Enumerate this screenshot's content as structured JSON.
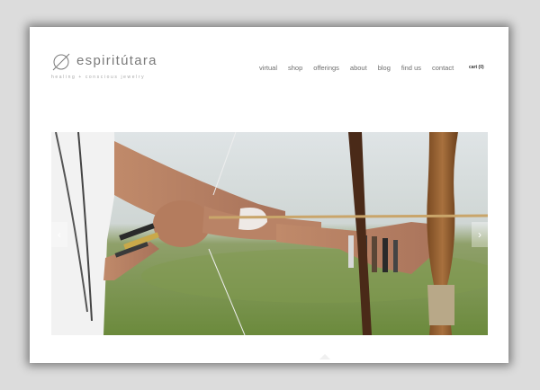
{
  "brand": {
    "name": "espiritútara",
    "tagline": "healing + conscious jewelry"
  },
  "nav": {
    "items": [
      {
        "label": "virtual"
      },
      {
        "label": "shop"
      },
      {
        "label": "offerings"
      },
      {
        "label": "about"
      },
      {
        "label": "blog"
      },
      {
        "label": "find us"
      },
      {
        "label": "contact"
      }
    ],
    "cart_label": "cart (0)"
  },
  "slider": {
    "prev_icon": "chevron-left-icon",
    "next_icon": "chevron-right-icon",
    "image": "archer-drawing-bow-photo"
  },
  "colors": {
    "background": "#dcdcdc",
    "page": "#ffffff",
    "text": "#6e6e6e"
  }
}
